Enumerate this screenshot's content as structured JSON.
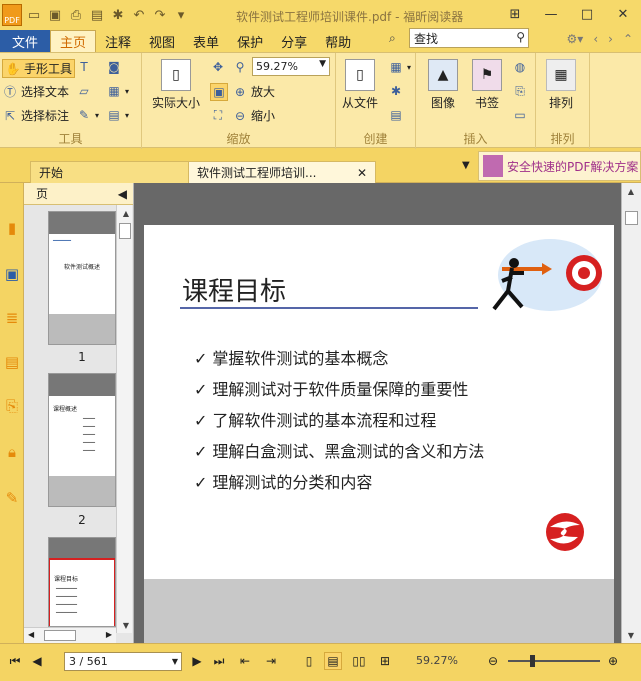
{
  "window": {
    "title": "软件测试工程师培训课件.pdf - 福昕阅读器",
    "app_logo": "PDF"
  },
  "menu": {
    "file": "文件",
    "tabs": [
      "主页",
      "注释",
      "视图",
      "表单",
      "保护",
      "分享",
      "帮助"
    ],
    "search_placeholder": "查找"
  },
  "ribbon": {
    "tools": {
      "hand": "手形工具",
      "select_text": "选择文本",
      "select_annot": "选择标注",
      "label": "工具"
    },
    "zoom": {
      "actual_size": "实际大小",
      "value": "59.27%",
      "zoom_in": "放大",
      "zoom_out": "缩小",
      "label": "缩放"
    },
    "create": {
      "from_file": "从文件",
      "label": "创建"
    },
    "insert": {
      "image": "图像",
      "bookmark": "书签",
      "label": "插入"
    },
    "arrange": {
      "arrange": "排列",
      "label": "排列"
    }
  },
  "doc_tabs": {
    "start": "开始",
    "current": "软件测试工程师培训...",
    "promo": "安全快速的PDF解决方案"
  },
  "thumbs": {
    "header": "页",
    "pages": [
      "1",
      "2"
    ],
    "page1_text": [
      "软件测试概述"
    ],
    "page2_title": "课程概述",
    "page3_title": "课程目标"
  },
  "page": {
    "title": "课程目标",
    "bullets": [
      "掌握软件测试的基本概念",
      "理解测试对于软件质量保障的重要性",
      "了解软件测试的基本流程和过程",
      "理解白盒测试、黑盒测试的含义和方法",
      "理解测试的分类和内容"
    ],
    "check": "✓"
  },
  "status": {
    "page_indicator": "3 / 561",
    "zoom": "59.27%"
  },
  "colors": {
    "accent": "#f4d463",
    "file_tab": "#2c5da6",
    "active_tab_text": "#d06a00"
  }
}
